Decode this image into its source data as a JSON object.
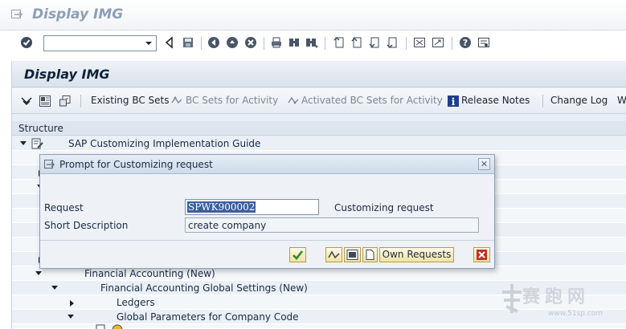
{
  "window": {
    "title": "Display IMG"
  },
  "system_toolbar": {
    "command_field": {
      "value": "",
      "placeholder": ""
    },
    "icons": [
      "enter-icon",
      "back-icon",
      "save-icon",
      "back-nav-icon",
      "exit-icon",
      "cancel-icon",
      "print-icon",
      "find-icon",
      "find-next-icon",
      "first-page-icon",
      "previous-page-icon",
      "next-page-icon",
      "last-page-icon",
      "new-session-icon",
      "shortcut-icon",
      "help-icon",
      "layout-icon"
    ]
  },
  "app": {
    "title": "Display IMG",
    "toolbar": {
      "existing_bc_sets": "Existing BC Sets",
      "bc_sets_for_activity": "BC Sets for Activity",
      "activated_bc_sets": "Activated BC Sets for Activity",
      "release_notes": "Release Notes",
      "change_log": "Change Log",
      "overflow": "W"
    }
  },
  "structure": {
    "header": "Structure",
    "rows": [
      {
        "label": "SAP Customizing Implementation Guide",
        "expanded": true
      },
      {
        "label": "Financial Accounting (New)",
        "expanded": true
      },
      {
        "label": "Financial Accounting Global Settings (New)",
        "expanded": true
      },
      {
        "label": "Ledgers",
        "expanded": false
      },
      {
        "label": "Global Parameters for Company Code",
        "expanded": true
      }
    ]
  },
  "dialog": {
    "title": "Prompt for Customizing request",
    "request_label": "Request",
    "request_value": "SPWK900002",
    "request_type": "Customizing request",
    "short_desc_label": "Short Description",
    "short_desc_value": "create company",
    "own_requests_label": "Own Requests",
    "close_glyph": "✕"
  },
  "watermark": {
    "text": "赛跑网",
    "url": "www.51sp.com"
  },
  "colors": {
    "accent": "#3b5fa0",
    "button_fill": "#f3e2a2",
    "frame": "#e8eef5"
  }
}
